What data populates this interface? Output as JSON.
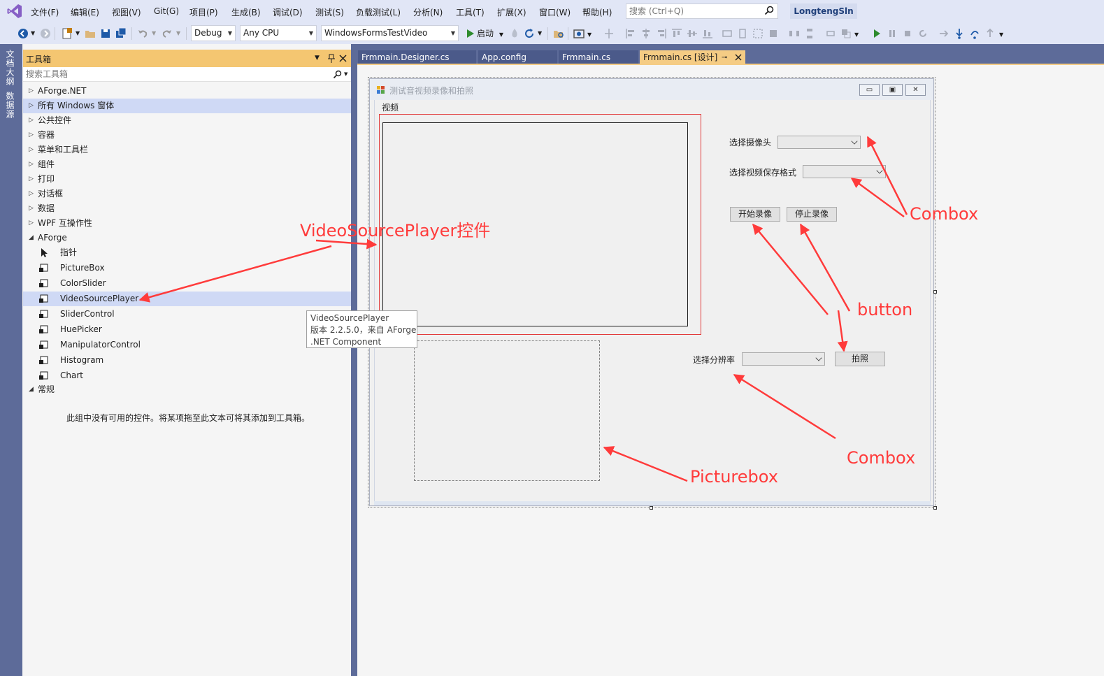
{
  "menubar": {
    "items": [
      "文件(F)",
      "编辑(E)",
      "视图(V)",
      "Git(G)",
      "项目(P)",
      "生成(B)",
      "调试(D)",
      "测试(S)",
      "负载测试(L)",
      "分析(N)",
      "工具(T)",
      "扩展(X)",
      "窗口(W)",
      "帮助(H)"
    ],
    "search_placeholder": "搜索 (Ctrl+Q)",
    "solution_name": "LongtengSln"
  },
  "toolbar": {
    "config": "Debug",
    "platform": "Any CPU",
    "startup_project": "WindowsFormsTestVideo",
    "start_label": "启动"
  },
  "left_strip": {
    "tabs": [
      "文档大纲",
      "数据源"
    ]
  },
  "toolbox": {
    "title": "工具箱",
    "search_placeholder": "搜索工具箱",
    "categories": [
      "AForge.NET",
      "所有 Windows 窗体",
      "公共控件",
      "容器",
      "菜单和工具栏",
      "组件",
      "打印",
      "对话框",
      "数据",
      "WPF 互操作性",
      "AForge"
    ],
    "aforge_items": [
      "指针",
      "PictureBox",
      "ColorSlider",
      "VideoSourcePlayer",
      "SliderControl",
      "HuePicker",
      "ManipulatorControl",
      "Histogram",
      "Chart"
    ],
    "general_category": "常规",
    "empty_hint": "此组中没有可用的控件。将某项拖至此文本可将其添加到工具箱。"
  },
  "tooltip": {
    "line1": "VideoSourcePlayer",
    "line2": "版本 2.2.5.0，来自 AForge",
    "line3": ".NET Component"
  },
  "doc_tabs": [
    "Frmmain.Designer.cs",
    "App.config",
    "Frmmain.cs",
    "Frmmain.cs [设计]"
  ],
  "form": {
    "title": "测试音视频录像和拍照",
    "video_group_label": "视频",
    "camera_label": "选择摄像头",
    "format_label": "选择视频保存格式",
    "start_record_button": "开始录像",
    "stop_record_button": "停止录像",
    "resolution_label": "选择分辨率",
    "snapshot_button": "拍照"
  },
  "annotations": {
    "video_player": "VideoSourcePlayer控件",
    "combox_top": "Combox",
    "button": "button",
    "combox_bottom": "Combox",
    "picturebox": "Picturebox"
  },
  "colors": {
    "accent": "#f5cc84",
    "annotation": "#ff3b3b",
    "chrome": "#5d6b99"
  }
}
